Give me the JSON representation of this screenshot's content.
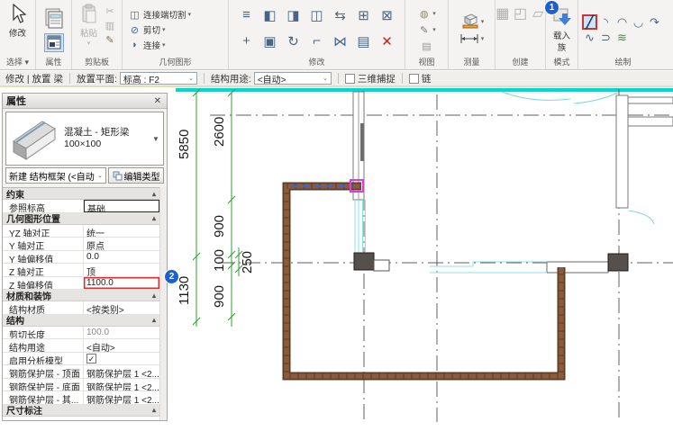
{
  "ribbon": {
    "panels": {
      "select": {
        "label": "选择 ▾",
        "modify_button": "修改"
      },
      "properties": {
        "label": "属性"
      },
      "clipboard": {
        "label": "剪贴板",
        "paste": "粘贴"
      },
      "geometry": {
        "label": "几何图形",
        "items": [
          "连接端切割",
          "剪切",
          "连接"
        ]
      },
      "modify": {
        "label": "修改"
      },
      "view": {
        "label": "视图"
      },
      "measure": {
        "label": "测量"
      },
      "create": {
        "label": "创建"
      },
      "mode": {
        "label": "模式",
        "load_family": "载入",
        "load_family2": "族",
        "badge": "1"
      },
      "draw": {
        "label": "绘制"
      }
    },
    "icons": {
      "cut_scissors": "✂",
      "copy_small": "▥",
      "match_brush": "✎",
      "geo_join_cut": "◫",
      "geo_cut": "⊘",
      "geo_join": "◗",
      "modify_row1": [
        "≡",
        "◧",
        "◨",
        "◫",
        "⇆",
        "⊞",
        "⊠"
      ],
      "modify_row2": [
        "+",
        "▣",
        "↻",
        "⌐",
        "⋈",
        "▤",
        "✕"
      ],
      "view_icons": [
        "◍",
        "✎",
        "▤"
      ],
      "create_icons": [
        "▦",
        "◰",
        "▱"
      ],
      "draw_row1": [
        "╱",
        "◝",
        "◠",
        "◡",
        "↷"
      ],
      "draw_row2": [
        "∿",
        "⊃",
        "≋"
      ]
    }
  },
  "options_bar": {
    "context": "修改 | 放置 梁",
    "placement_plane_label": "放置平面:",
    "placement_plane_value": "标高 : F2",
    "structural_usage_label": "结构用途:",
    "structural_usage_value": "<自动>",
    "snap_3d_label": "三维捕捉",
    "chain_label": "链"
  },
  "properties_panel": {
    "title": "属性",
    "close": "✕",
    "type_name": "混凝土 - 矩形梁",
    "type_size": "100×100",
    "instance_combo": "新建 结构框架 (<自动",
    "edit_type": "编辑类型",
    "badge": "2",
    "rows": [
      {
        "section": "约束"
      },
      {
        "label": "参照标高",
        "value": "基础",
        "boxed": true
      },
      {
        "section": "几何图形位置"
      },
      {
        "label": "YZ 轴对正",
        "value": "统一"
      },
      {
        "label": "Y 轴对正",
        "value": "原点"
      },
      {
        "label": "Y 轴偏移值",
        "value": "0.0"
      },
      {
        "label": "Z 轴对正",
        "value": "顶"
      },
      {
        "label": "Z 轴偏移值",
        "value": "1100.0",
        "red": true
      },
      {
        "section": "材质和装饰"
      },
      {
        "label": "结构材质",
        "value": "<按类别>"
      },
      {
        "section": "结构"
      },
      {
        "label": "剪切长度",
        "value": "100.0",
        "disabled": true
      },
      {
        "label": "结构用途",
        "value": "<自动>"
      },
      {
        "label": "启用分析模型",
        "checkbox": true
      },
      {
        "label": "钢筋保护层 - 顶面",
        "value": "钢筋保护层 1 <2..."
      },
      {
        "label": "钢筋保护层 - 底面",
        "value": "钢筋保护层 1 <2..."
      },
      {
        "label": "钢筋保护层 - 其...",
        "value": "钢筋保护层 1 <2..."
      },
      {
        "section": "尺寸标注"
      }
    ]
  },
  "canvas": {
    "dimensions": {
      "overall": "5850",
      "lower_overall": "1130",
      "d1": "2600",
      "d2": "900",
      "d3": "100",
      "d4": "900",
      "d5": "250"
    },
    "colors": {
      "selection_cyan": "#00d8d8",
      "dimension_green": "#2fa02f",
      "beam_brown": "#8a5c3e",
      "snap_magenta": "#e23ae2",
      "centerline_blue": "#3a66cc"
    }
  }
}
